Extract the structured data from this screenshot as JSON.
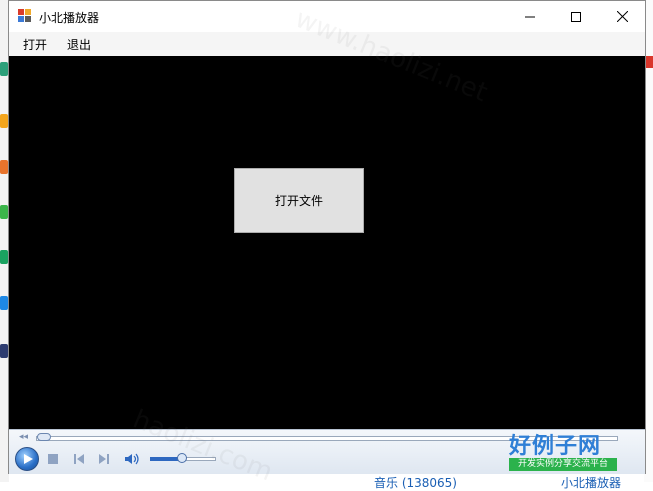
{
  "window": {
    "title": "小北播放器",
    "controls": [
      "minimize-icon",
      "maximize-icon",
      "close-icon"
    ]
  },
  "menu": {
    "items": [
      "打开",
      "退出"
    ]
  },
  "video": {
    "open_button_label": "打开文件"
  },
  "player": {
    "seek_position": 0.0,
    "volume_level": 0.5,
    "buttons": [
      "play-icon",
      "stop-icon",
      "previous-icon",
      "next-icon",
      "volume-icon"
    ]
  },
  "watermark": {
    "title": "好例子网",
    "subtitle": "开发实例分享交流平台"
  },
  "background": {
    "bottom_left_text": "音乐 (138065)",
    "bottom_right_text": "小北播放器"
  },
  "colors": {
    "video_bg": "#000000",
    "button_face": "#e1e1e1",
    "link": "#1a5fb4",
    "watermark_blue": "#2f7fd6",
    "watermark_green": "#2bb24c"
  }
}
